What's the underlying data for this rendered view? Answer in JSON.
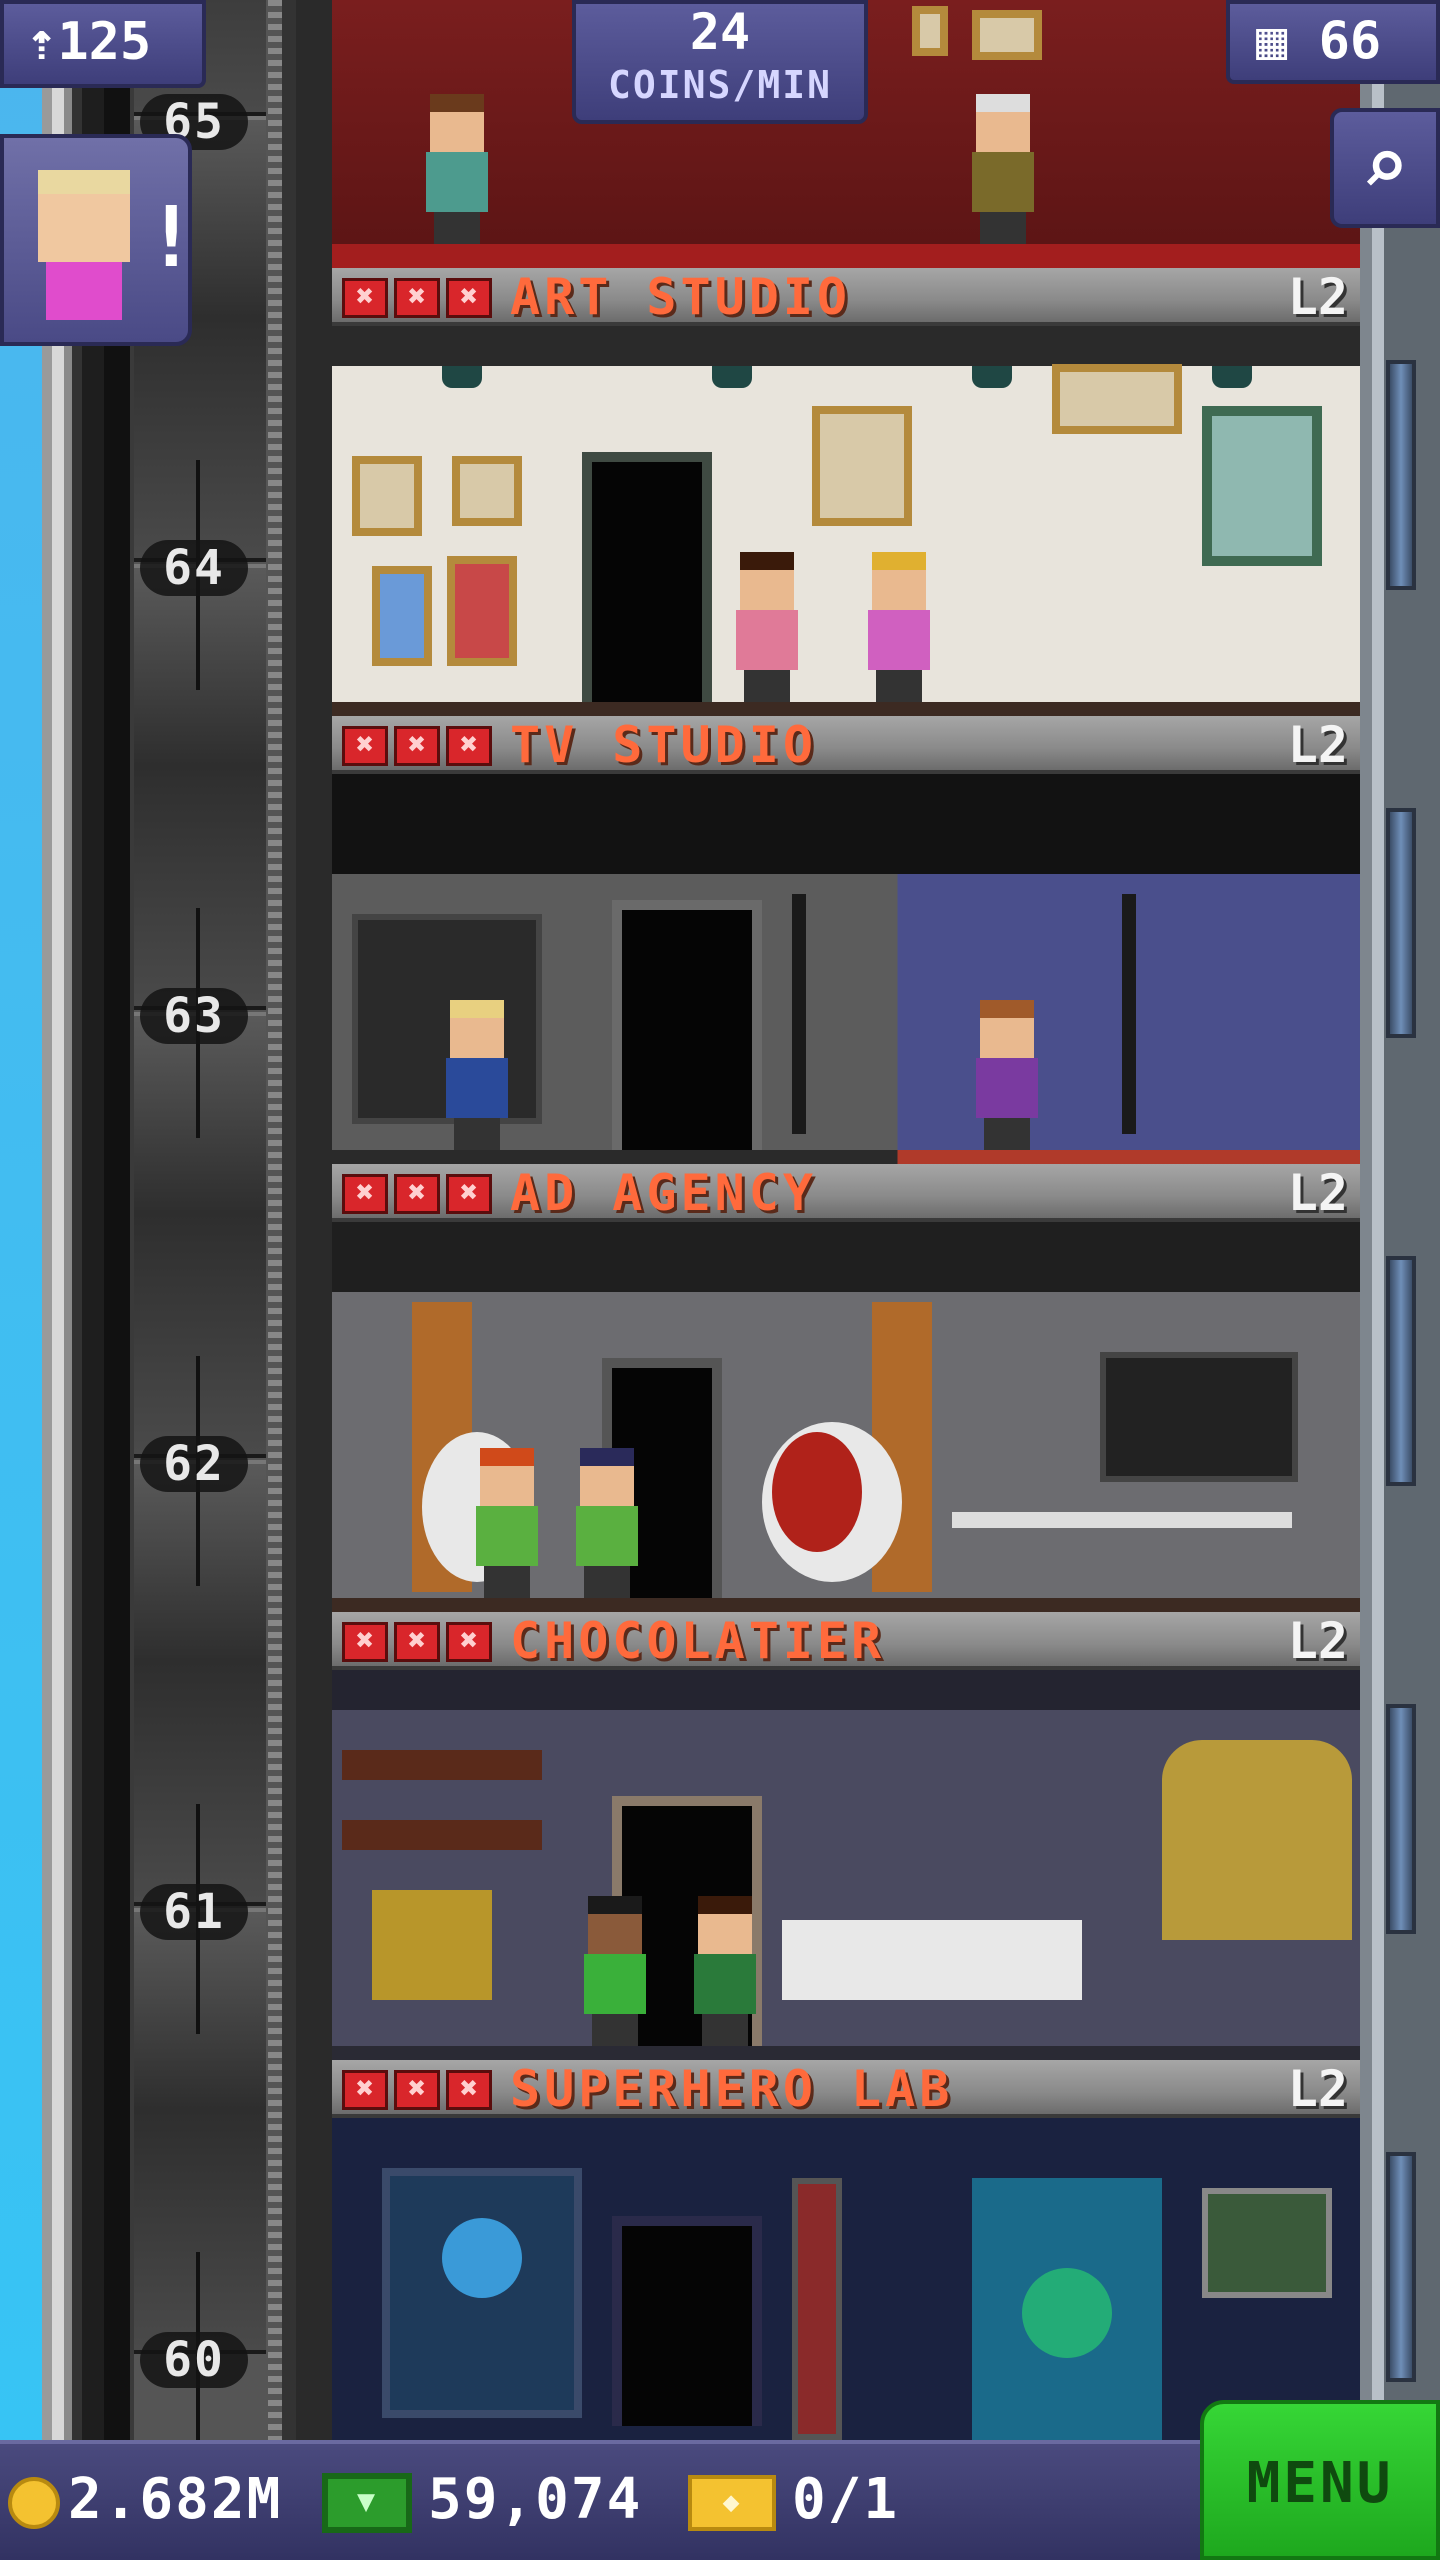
{
  "hud": {
    "population": "125",
    "coins_per_min_value": "24",
    "coins_per_min_label": "COINS/MIN",
    "floor_count": "66",
    "icons": {
      "population": "person-up-icon",
      "floors": "building-icon",
      "search": "magnifier-icon"
    }
  },
  "visitor": {
    "alert": "!",
    "icon": "visitor-avatar-icon"
  },
  "shaft": {
    "floor_numbers": [
      "65",
      "64",
      "63",
      "62",
      "61",
      "60"
    ]
  },
  "floors": [
    {
      "name": "ART STUDIO",
      "level": "L2",
      "stars": [
        "✖",
        "✖",
        "✖"
      ]
    },
    {
      "name": "TV STUDIO",
      "level": "L2",
      "stars": [
        "✖",
        "✖",
        "✖"
      ]
    },
    {
      "name": "AD AGENCY",
      "level": "L2",
      "stars": [
        "✖",
        "✖",
        "✖"
      ]
    },
    {
      "name": "CHOCOLATIER",
      "level": "L2",
      "stars": [
        "✖",
        "✖",
        "✖"
      ]
    },
    {
      "name": "SUPERHERO LAB",
      "level": "L2",
      "stars": [
        "✖",
        "✖",
        "✖"
      ]
    }
  ],
  "bottom_bar": {
    "coins": "2.682M",
    "bux": "59,074",
    "tickets": "0/1",
    "menu_label": "MENU",
    "icons": {
      "coins": "coin-icon",
      "bux": "bux-icon",
      "tickets": "ticket-icon"
    }
  },
  "colors": {
    "star_red": "#d9262b",
    "floor_name_orange": "#ff6a3c",
    "hud_purple": "#4a4a86",
    "menu_green": "#2ac22a"
  }
}
